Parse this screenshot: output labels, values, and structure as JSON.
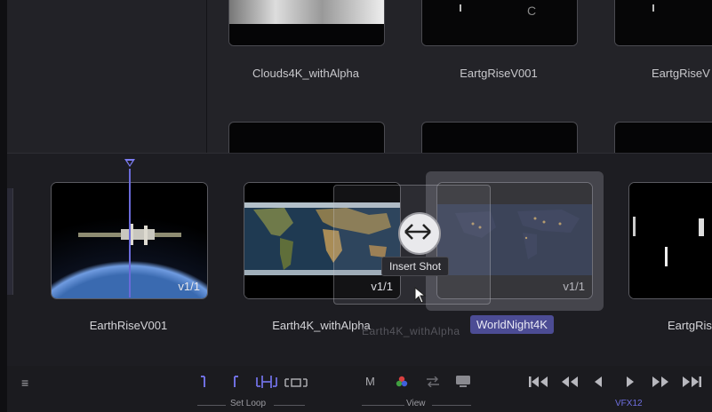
{
  "media_pool": {
    "clips": [
      {
        "name": "Clouds4K_withAlpha"
      },
      {
        "name": "EartgRiseV001"
      },
      {
        "name": "EartgRiseV"
      }
    ]
  },
  "timeline": {
    "clips": [
      {
        "name": "EarthRiseV001",
        "version": "v1/1"
      },
      {
        "name": "Earth4K_withAlpha",
        "version": "v1/1"
      },
      {
        "name": "WorldNight4K",
        "version": "v1/1"
      },
      {
        "name": "EartgRis",
        "version": ""
      }
    ],
    "tooltip": "Insert Shot",
    "ghost_text": "Earth4K_withAlpha"
  },
  "toolbar": {
    "menu_icon": "≡",
    "set_loop_label": "Set Loop",
    "view_label": "View",
    "m_label": "M",
    "project_label": "VFX12"
  },
  "colors": {
    "accent": "#6f6fe0",
    "selected_bg": "#4c4c94",
    "background": "#1b1b1f"
  }
}
